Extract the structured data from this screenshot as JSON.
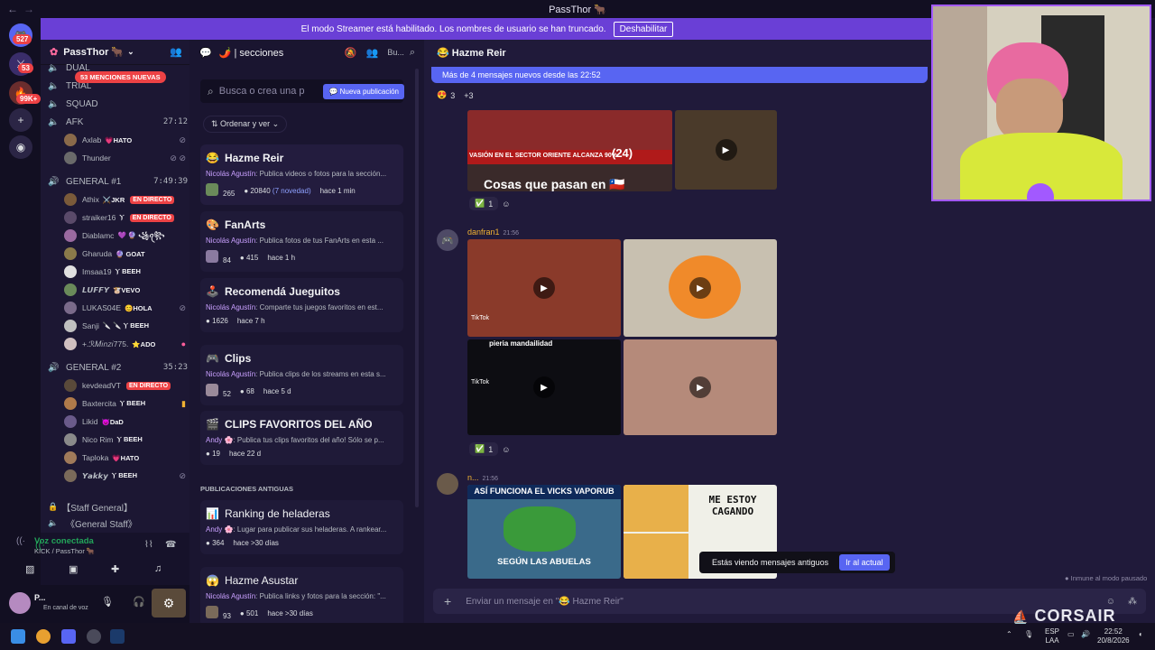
{
  "window": {
    "title": "PassThor 🐂",
    "back": "←",
    "forward": "→"
  },
  "rail": {
    "home_badge": "527",
    "badge2": "53",
    "badge3": "99K+"
  },
  "banner": {
    "text": "El modo Streamer está habilitado. Los nombres de usuario se han truncado.",
    "button": "Deshabilitar"
  },
  "server": {
    "name": "PassThor 🐂"
  },
  "mentions_badge": "53 MENCIONES NUEVAS",
  "channels": [
    {
      "name": "DUAL",
      "time": ""
    },
    {
      "name": "TRIAL",
      "time": ""
    },
    {
      "name": "SQUAD",
      "time": ""
    },
    {
      "name": "AFK",
      "time": "27:12"
    },
    {
      "name": "GENERAL #1",
      "time": "7:49:39"
    },
    {
      "name": "GENERAL #2",
      "time": "35:23"
    }
  ],
  "afk_users": [
    {
      "name": "Axlab",
      "tag": "💗HATO",
      "color": "#8a6a4a"
    },
    {
      "name": "Thunder",
      "tag": "",
      "color": "#6a6a6a"
    }
  ],
  "g1_users": [
    {
      "name": "Athix",
      "tag": "⚔️JKR",
      "live": "EN DIRECTO",
      "color": "#7a5a3a"
    },
    {
      "name": "straiker16",
      "tag": "Ⲩ",
      "live": "EN DIRECTO",
      "color": "#5a4a6a"
    },
    {
      "name": "Diablamc",
      "tag": "💜 🔮 ꧁ꪖ꧂",
      "live": "",
      "color": "#9a6aa0"
    },
    {
      "name": "Gharuda",
      "tag": "🔮 GOAT",
      "live": "",
      "color": "#8a7a4a"
    },
    {
      "name": "Imsaa19",
      "tag": "Ⲩ BEEH",
      "live": "",
      "color": "#e0e0e0"
    },
    {
      "name": "𝙇𝙐𝙁𝙁𝙔",
      "tag": "🐮VEVO",
      "live": "",
      "color": "#6a8a5a"
    },
    {
      "name": "LUKAS04E",
      "tag": "😊HOLA",
      "live": "",
      "color": "#7a6a8a"
    },
    {
      "name": "Sanji",
      "tag": "🔪 🔪 Ⲩ BEEH",
      "live": "",
      "color": "#c0c0c0"
    },
    {
      "name": "+.ℛ𝑀𝑖𝑛𝑧𝑖775.",
      "tag": "⭐ADO",
      "live": "",
      "color": "#d0c0c0"
    }
  ],
  "g2_users": [
    {
      "name": "kevdeadVT",
      "tag": "",
      "live": "EN DIRECTO",
      "color": "#5a4a3a"
    },
    {
      "name": "Baxtercita",
      "tag": "Ⲩ BEEH",
      "live": "",
      "color": "#b07a4a"
    },
    {
      "name": "Likid",
      "tag": "😈DaD",
      "live": "",
      "color": "#6a5a8a"
    },
    {
      "name": "Nico Rim",
      "tag": "Ⲩ BEEH",
      "live": "",
      "color": "#8a8a8a"
    },
    {
      "name": "Taploka",
      "tag": "💗HATO",
      "live": "",
      "color": "#a07a5a"
    },
    {
      "name": "𝙔𝙖𝙠𝙠𝙮",
      "tag": "Ⲩ BEEH",
      "live": "",
      "color": "#7a6a5a"
    }
  ],
  "staff": {
    "category": "【Staff General】",
    "channel": "《General Staff》"
  },
  "voice": {
    "status": "Voz conectada",
    "where": "KICK / PassThor 🐂"
  },
  "user": {
    "name": "P...",
    "status": "En canal de voz"
  },
  "forum": {
    "header": "🌶️ | secciones",
    "search_ph": "Busca o crea una p",
    "new_post": "Nueva publicación",
    "sort": "Ordenar y ver",
    "old_section": "PUBLICACIONES ANTIGUAS",
    "posts": [
      {
        "icon": "😂",
        "title": "Hazme Reir",
        "author": "Nicolás Agustín",
        "text": ": Publica videos o fotos para la sección...",
        "reacts": "265",
        "msgs": "20840",
        "new": "(7 novedad)",
        "time": "hace 1 min"
      },
      {
        "icon": "🎨",
        "title": "FanArts",
        "author": "Nicolás Agustín",
        "text": ": Publica fotos de tus FanArts en esta ...",
        "reacts": "84",
        "msgs": "415",
        "new": "",
        "time": "hace 1 h"
      },
      {
        "icon": "🕹️",
        "title": "Recomendá Jueguitos",
        "author": "Nicolás Agustín",
        "text": ": Comparte tus juegos favoritos en est...",
        "reacts": "",
        "msgs": "1626",
        "new": "",
        "time": "hace 7 h"
      },
      {
        "icon": "🎮",
        "title": "Clips",
        "author": "Nicolás Agustín",
        "text": ": Publica clips de los streams en esta s...",
        "reacts": "52",
        "msgs": "68",
        "new": "",
        "time": "hace 5 d"
      },
      {
        "icon": "🎬",
        "title": "CLIPS FAVORITOS DEL AÑO",
        "author": "Andy 🌸",
        "text": ": Publica tus clips favoritos del año! Sólo se p...",
        "reacts": "",
        "msgs": "19",
        "new": "",
        "time": "hace 22 d"
      },
      {
        "icon": "📊",
        "title": "Ranking de heladeras",
        "author": "Andy 🌸",
        "text": ": Lugar para publicar sus heladeras. A rankear...",
        "reacts": "",
        "msgs": "364",
        "new": "",
        "time": "hace >30 días"
      },
      {
        "icon": "😱",
        "title": "Hazme Asustar",
        "author": "Nicolás Agustín",
        "text": ": Publica links y fotos para la sección: \"...",
        "reacts": "93",
        "msgs": "501",
        "new": "",
        "time": "hace >30 días"
      }
    ]
  },
  "chat": {
    "header": "😂 Hazme Reir",
    "new_msgs": "Más de 4 mensajes nuevos desde las 22:52",
    "top_reacts": {
      "count": "3",
      "more": "+3"
    },
    "img1_caption": "Cosas que pasan en 🇨🇱",
    "img1_news": "VASIÓN EN EL SECTOR ORIENTE ALCANZA 90%",
    "img1_badge": "(24)",
    "msg2_author": "danfran1",
    "msg2_time": "21:56",
    "msg3_author": "n...",
    "msg3_time": "21:56",
    "reaction_count": "1",
    "tiktok": "TikTok",
    "meme_left_top": "ASÍ FUNCIONA EL VICKS VAPORUB",
    "meme_left_bottom": "SEGÚN LAS ABUELAS",
    "meme_right": "ME ESTOY CAGANDO",
    "clip_caption": "pieria mandailidad",
    "composer": "Enviar un mensaje en \"😂 Hazme Reir\"",
    "toast": "Estás viendo mensajes antiguos",
    "toast_btn": "Ir al actual",
    "immune": "Inmune al modo pausado"
  },
  "taskbar": {
    "brand": "CORSAIR",
    "lang1": "ESP",
    "lang2": "LAA",
    "time": "22:52",
    "date": "20/8/2026"
  }
}
